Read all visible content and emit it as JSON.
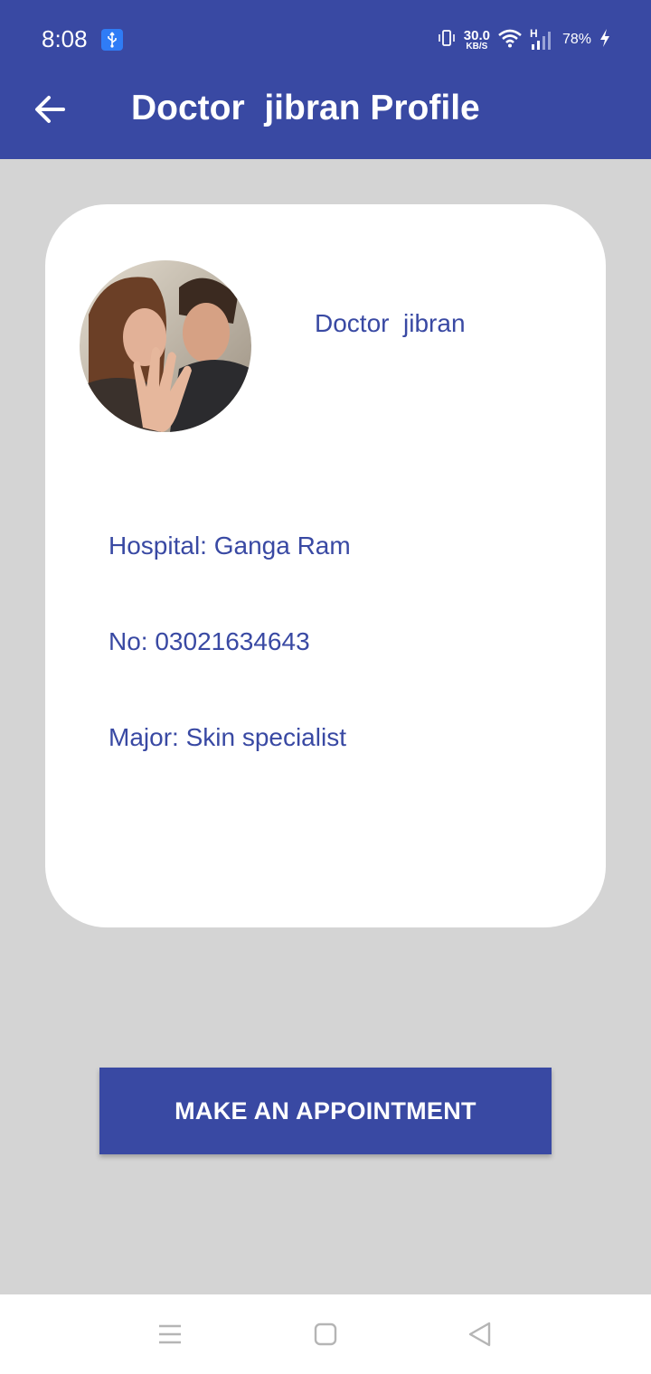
{
  "status_bar": {
    "time": "8:08",
    "net_speed_value": "30.0",
    "net_speed_unit": "KB/S",
    "network_type": "H",
    "battery": "78%"
  },
  "header": {
    "title": "Doctor  jibran Profile"
  },
  "profile": {
    "name": "Doctor  jibran",
    "hospital": "Hospital: Ganga Ram",
    "phone": "No: 03021634643",
    "major": "Major: Skin specialist"
  },
  "actions": {
    "appointment_label": "MAKE AN APPOINTMENT"
  },
  "colors": {
    "primary": "#3949a3",
    "background": "#d4d4d4",
    "card": "#ffffff"
  },
  "icons": [
    "usb-icon",
    "vibrate-icon",
    "wifi-icon",
    "signal-icon",
    "charging-icon",
    "back-arrow-icon",
    "menu-icon",
    "home-icon",
    "back-icon"
  ]
}
